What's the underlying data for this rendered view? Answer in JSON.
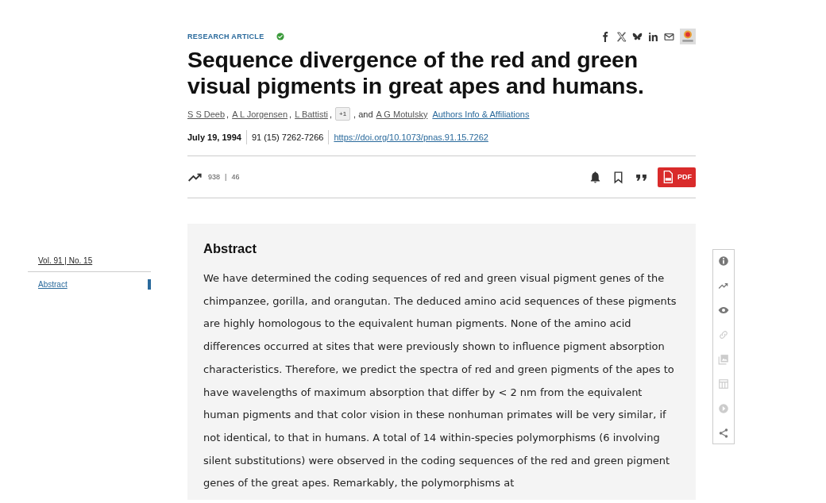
{
  "article_type": "RESEARCH ARTICLE",
  "open_access": true,
  "share_icons": [
    {
      "kind": "facebook"
    },
    {
      "kind": "x"
    },
    {
      "kind": "bluesky"
    },
    {
      "kind": "linkedin"
    },
    {
      "kind": "email"
    },
    {
      "kind": "crossmark"
    }
  ],
  "title": "Sequence divergence of the red and green visual pigments in great apes and humans.",
  "authors": [
    {
      "name": "S S Deeb",
      "sep": ","
    },
    {
      "name": "A L Jorgensen",
      "sep": ","
    },
    {
      "name": "L Battisti",
      "sep": ","
    }
  ],
  "more_authors": "+1",
  "and_text": ", and",
  "last_author": "A G Motulsky",
  "affiliations_link": "Authors Info & Affiliations",
  "date": "July 19, 1994",
  "citation": "91 (15) 7262-7266",
  "doi": "https://doi.org/10.1073/pnas.91.15.7262",
  "metrics": {
    "views": "938",
    "separator": "|",
    "citations": "46"
  },
  "actions": [
    {
      "kind": "alert"
    },
    {
      "kind": "bookmark"
    },
    {
      "kind": "cite"
    },
    {
      "kind": "pdf",
      "label": "PDF"
    }
  ],
  "sidebar": {
    "issue": "Vol. 91 | No. 15",
    "items": [
      {
        "label": "Abstract",
        "selected": true
      }
    ]
  },
  "abstract": {
    "heading": "Abstract",
    "text": "We have determined the coding sequences of red and green visual pigment genes of the chimpanzee, gorilla, and orangutan. The deduced amino acid sequences of these pigments are highly homologous to the equivalent human pigments. None of the amino acid differences occurred at sites that were previously shown to influence pigment absorption characteristics. Therefore, we predict the spectra of red and green pigments of the apes to have wavelengths of maximum absorption that differ by < 2 nm from the equivalent human pigments and that color vision in these nonhuman primates will be very similar, if not identical, to that in humans. A total of 14 within-species polymorphisms (6 involving silent substitutions) were observed in the coding sequences of the red and green pigment genes of the great apes. Remarkably, the polymorphisms at"
  },
  "tools": [
    {
      "kind": "info",
      "disabled": false
    },
    {
      "kind": "trend",
      "disabled": false
    },
    {
      "kind": "eye",
      "disabled": false
    },
    {
      "kind": "link",
      "disabled": true
    },
    {
      "kind": "images",
      "disabled": true
    },
    {
      "kind": "table",
      "disabled": true
    },
    {
      "kind": "play",
      "disabled": true
    },
    {
      "kind": "share",
      "disabled": false
    }
  ]
}
